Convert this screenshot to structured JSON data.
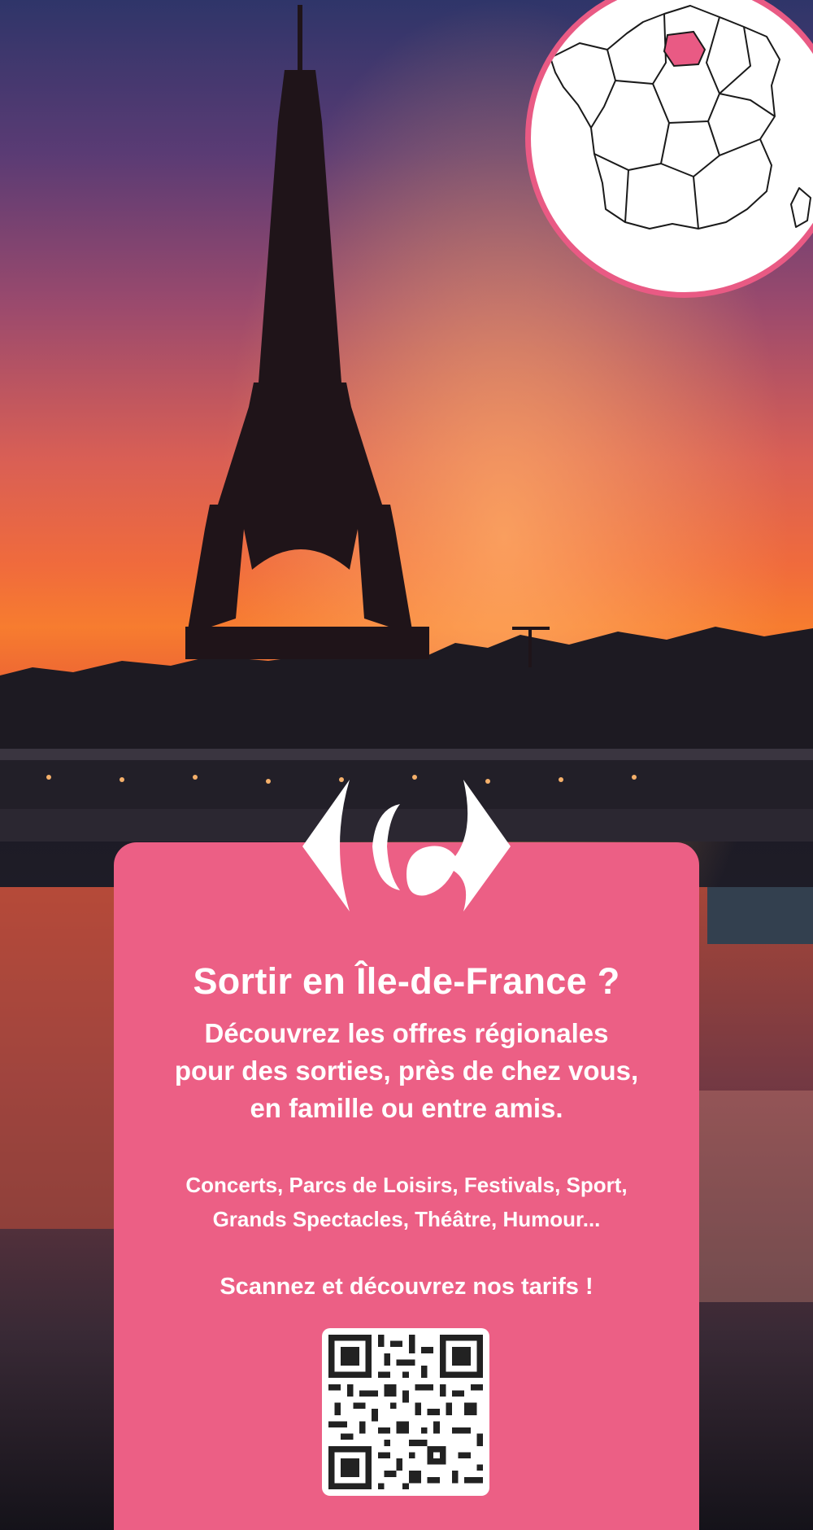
{
  "brand": {
    "logo_icon": "carrefour-logo-icon",
    "card_color": "#ec5f85",
    "map_highlight_color": "#e95a84"
  },
  "map": {
    "icon": "france-map-icon",
    "highlighted_region": "Île-de-France"
  },
  "card": {
    "headline": "Sortir en Île-de-France ?",
    "intro_lines": [
      "Découvrez les offres régionales",
      "pour des sorties, près de chez vous,",
      "en famille ou entre amis."
    ],
    "categories_lines": [
      "Concerts, Parcs de Loisirs, Festivals, Sport,",
      "Grands Spectacles, Théâtre, Humour..."
    ],
    "cta": "Scannez et découvrez nos tarifs !",
    "qr_icon": "qr-code-icon"
  }
}
